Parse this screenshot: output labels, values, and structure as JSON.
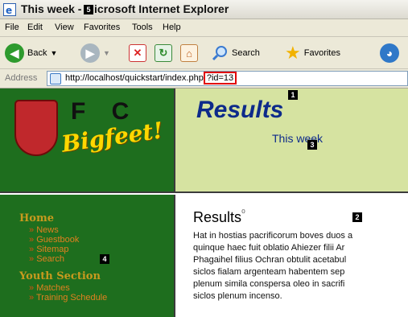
{
  "window": {
    "title": "This week - Microsoft Internet Explorer"
  },
  "menu": [
    "File",
    "Edit",
    "View",
    "Favorites",
    "Tools",
    "Help"
  ],
  "toolbar": {
    "back": "Back",
    "search": "Search",
    "favorites": "Favorites"
  },
  "address": {
    "label": "Address",
    "url_base": "http://localhost/quickstart/index.php",
    "url_query": "?id=13"
  },
  "page": {
    "logo": {
      "fc": "F C",
      "name": "Bigfeet!"
    },
    "header": {
      "title": "Results",
      "subtitle": "This week"
    },
    "nav": [
      {
        "heading": "Home",
        "items": [
          "News",
          "Guestbook",
          "Sitemap",
          "Search"
        ]
      },
      {
        "heading": "Youth Section",
        "items": [
          "Matches",
          "Training Schedule"
        ]
      }
    ],
    "content": {
      "title": "Results",
      "paragraph": [
        "Hat in hostias pacrificorum boves duos a",
        "quinque haec fuit oblatio Ahiezer filii Ar",
        "Phagaihel filius Ochran obtulit acetabul",
        "siclos fialam argenteam habentem sep",
        "plenum simila conspersa oleo in sacrifi",
        "siclos plenum incenso."
      ]
    }
  },
  "markers": [
    "1",
    "2",
    "3",
    "4",
    "5"
  ]
}
